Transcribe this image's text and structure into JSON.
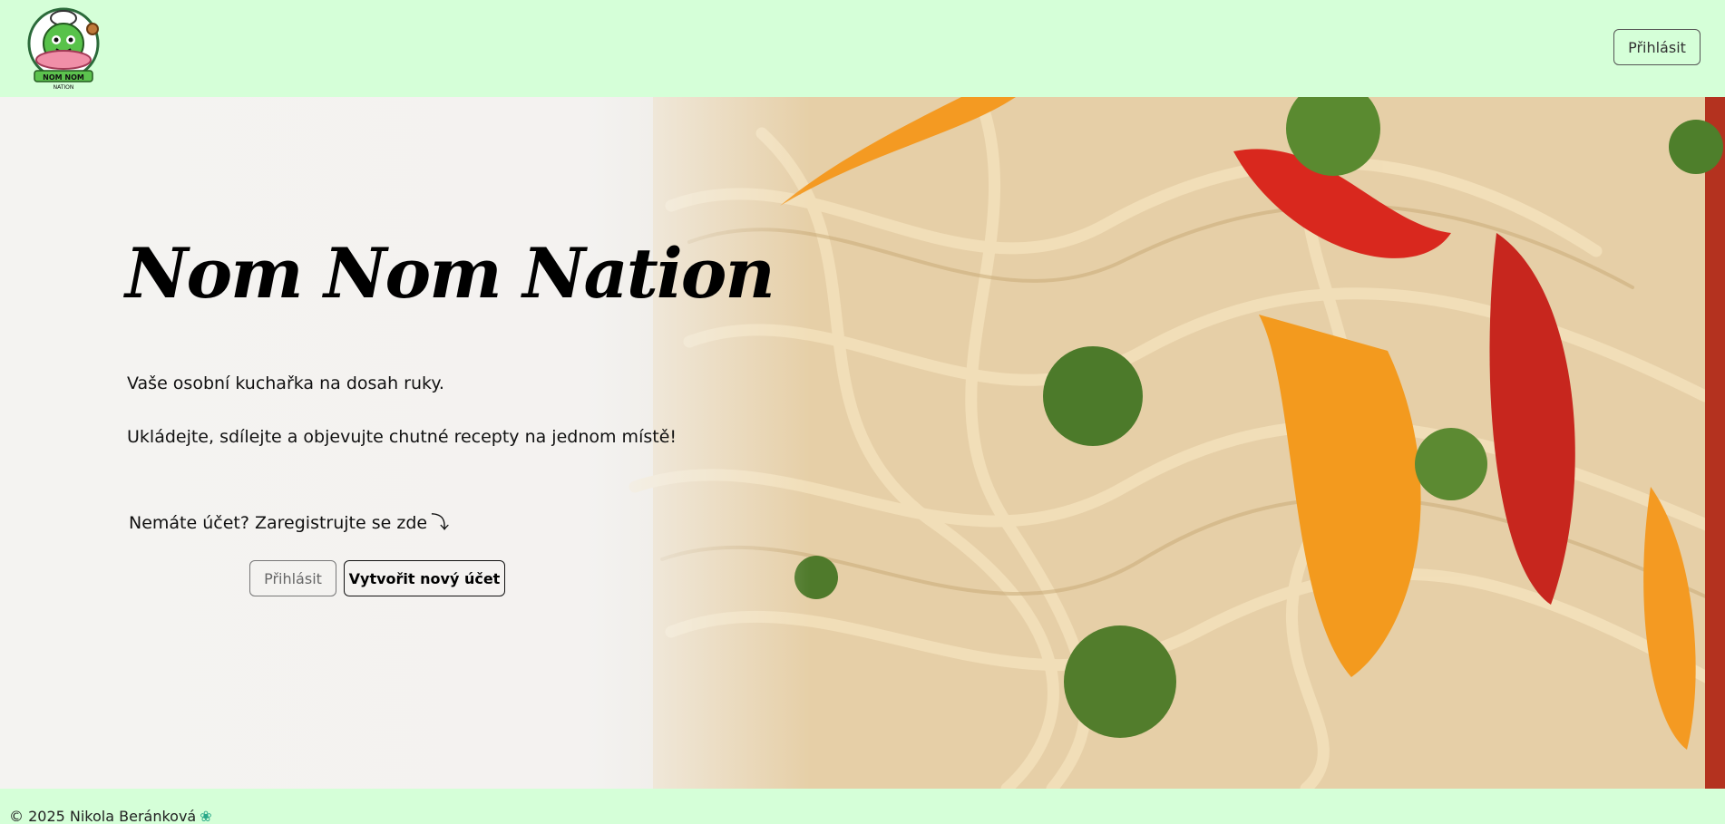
{
  "header": {
    "logo_text": "NOM NOM NATION",
    "login_label": "Přihlásit"
  },
  "hero": {
    "title": "Nom Nom Nation",
    "subtitle_1": "Vaše osobní kuchařka na dosah ruky.",
    "subtitle_2": "Ukládejte, sdílejte a objevujte chutné recepty na jednom místě!",
    "register_prompt": "Nemáte účet? Zaregistrujte se zde",
    "arrow_icon": "curved-arrow-down-icon",
    "login_label": "Přihlásit",
    "create_account_label": "Vytvořit nový účet",
    "image": "noodles-with-vegetables"
  },
  "footer": {
    "copyright": "© 2025 Nikola Beránková",
    "icon": "lotus-icon"
  },
  "colors": {
    "mint_background": "#d5ffd8",
    "text": "#111111",
    "footer_icon": "#2aa889"
  }
}
